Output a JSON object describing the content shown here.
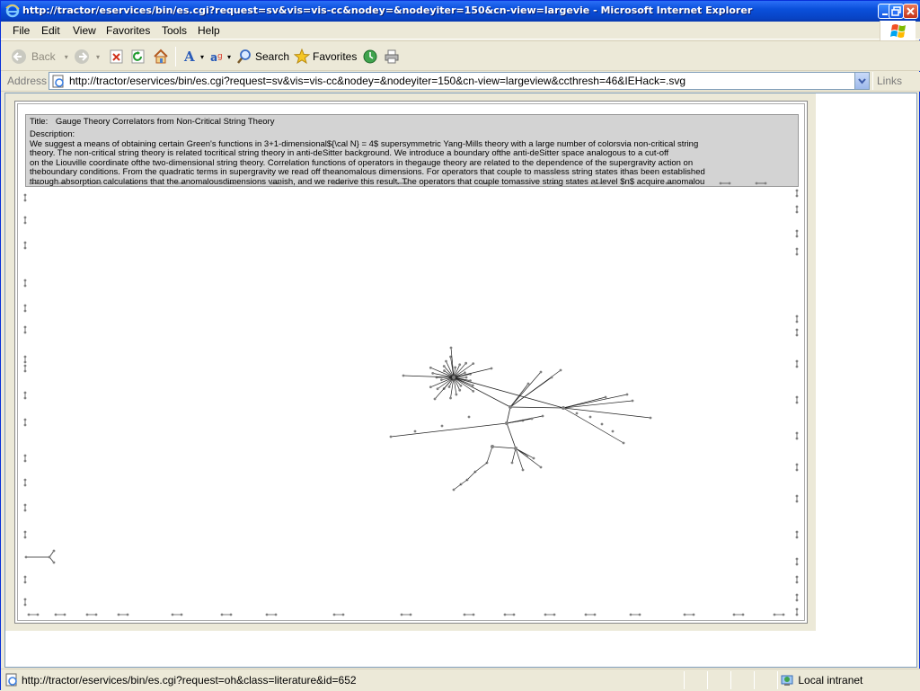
{
  "window": {
    "title": "http://tractor/eservices/bin/es.cgi?request=sv&vis=vis-cc&nodey=&nodeyiter=150&cn-view=largevie - Microsoft Internet Explorer"
  },
  "menu": {
    "items": [
      {
        "label": "File"
      },
      {
        "label": "Edit"
      },
      {
        "label": "View"
      },
      {
        "label": "Favorites"
      },
      {
        "label": "Tools"
      },
      {
        "label": "Help"
      }
    ]
  },
  "toolbar": {
    "back_label": "Back",
    "search_label": "Search",
    "favorites_label": "Favorites"
  },
  "address": {
    "label": "Address",
    "url": "http://tractor/eservices/bin/es.cgi?request=sv&vis=vis-cc&nodey=&nodeyiter=150&cn-view=largeview&ccthresh=46&IEHack=.svg",
    "links_label": "Links"
  },
  "document": {
    "title_label": "Title:",
    "title": "Gauge Theory Correlators from Non-Critical String Theory",
    "description_label": "Description:",
    "description_lines": [
      "We suggest a means of obtaining certain Green's functions in 3+1-dimensional${\\cal N} = 4$ supersymmetric Yang-Mills theory with a large number of colorsvia non-critical string",
      "theory. The non-critical string theory is related tocritical string theory in anti-deSitter background. We introduce a boundary ofthe anti-deSitter space analogous to a cut-off",
      "on the Liouville coordinate ofthe two-dimensional string theory. Correlation functions of operators in thegauge theory are related to the dependence of the supergravity action on",
      "theboundary conditions. From the quadratic terms in supergravity we read off theanomalous dimensions. For operators that couple to massless string states ithas been established",
      "through absorption calculations that the anomalousdimensions vanish, and we rederive this result. The operators that couple tomassive string states at level $n$ acquire anomalou"
    ]
  },
  "status": {
    "text": "http://tractor/eservices/bin/es.cgi?request=oh&class=literature&id=652",
    "zone": "Local intranet"
  },
  "colors": {
    "titlebar": "#0A50DB",
    "chrome": "#ECE9D8",
    "graph_node": "#808080",
    "graph_edge": "#222222",
    "header_bg": "#D3D3D3"
  }
}
